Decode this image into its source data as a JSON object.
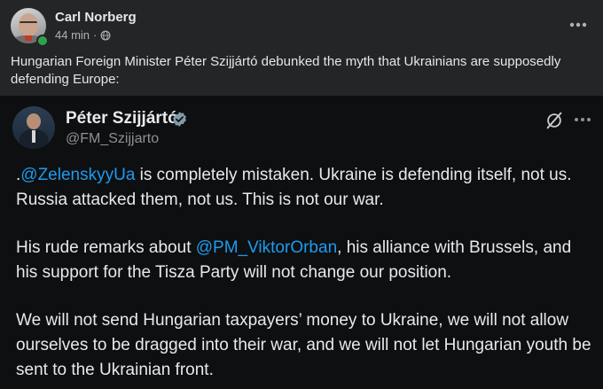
{
  "post": {
    "author": "Carl Norberg",
    "time": "44 min",
    "separator": "·",
    "visibility_icon": "globe-icon",
    "more_icon": "more-horizontal-icon",
    "caption": "Hungarian Foreign Minister Péter Szijjártó debunked the myth that Ukrainians are supposedly defending Europe:"
  },
  "tweet": {
    "name": "Péter Szijjártó",
    "handle": "@FM_Szijjarto",
    "verified_icon": "verified-badge-icon",
    "grok_icon": "grok-icon",
    "more_icon": "more-horizontal-icon",
    "p1": {
      "prefix": ".",
      "mention": "@ZelenskyyUa",
      "text": " is completely mistaken. Ukraine is defending itself, not us. Russia attacked them, not us. This is not our war."
    },
    "p2": {
      "prefix": "His rude remarks about ",
      "mention": "@PM_ViktorOrban",
      "text": ", his alliance with Brussels, and his support for the Tisza Party will not change our position."
    },
    "p3": {
      "text": "We will not send Hungarian taxpayers’ money to Ukraine, we will not allow ourselves to be dragged into their war, and we will not let Hungarian youth be sent to the Ukrainian front."
    }
  },
  "colors": {
    "background": "#242526",
    "tweet_background": "#0e0f10",
    "mention": "#1d9bf0",
    "verified": "#829aab",
    "online": "#31a24c"
  }
}
